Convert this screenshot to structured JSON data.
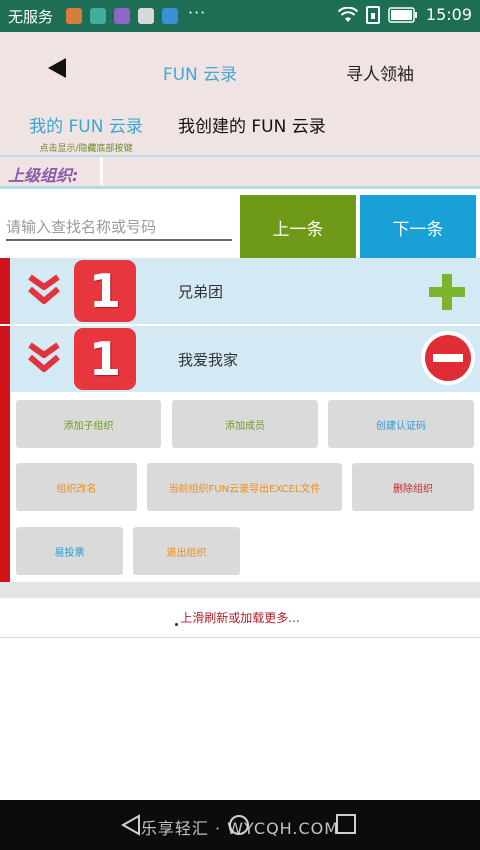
{
  "status_bar": {
    "carrier": "无服务",
    "more": "···",
    "time": "15:09"
  },
  "header": {
    "title": "FUN 云录",
    "find_leader": "寻人领袖",
    "tabs": [
      {
        "label": "我的 FUN 云录",
        "sublabel": "点击显示/隐藏底部按键"
      },
      {
        "label": "我创建的 FUN 云录"
      }
    ]
  },
  "parent_org": {
    "label": "上级组织:"
  },
  "search": {
    "placeholder": "请输入查找名称或号码",
    "prev_label": "上一条",
    "next_label": "下一条"
  },
  "orgs": [
    {
      "badge": "1",
      "name": "兄弟团"
    },
    {
      "badge": "1",
      "name": "我爱我家"
    }
  ],
  "actions": [
    {
      "label": "添加子组织"
    },
    {
      "label": "添加成员"
    },
    {
      "label": "创建认证码"
    },
    {
      "label": "组织改名"
    },
    {
      "label": "当前组织FUN云录导出EXCEL文件"
    },
    {
      "label": "删除组织"
    },
    {
      "label": "易投票"
    },
    {
      "label": "退出组织"
    }
  ],
  "refresh": {
    "text": "上滑刷新或加载更多..."
  },
  "watermark": "乐享轻汇 · WYCQH.COM",
  "colors": {
    "status_bar": "#1e6e55",
    "header_bg": "#f0e3e3",
    "accent_blue": "#19a0d6",
    "accent_green": "#6e9a17",
    "red": "#d0121b",
    "row_bg": "#d3e9f3"
  }
}
